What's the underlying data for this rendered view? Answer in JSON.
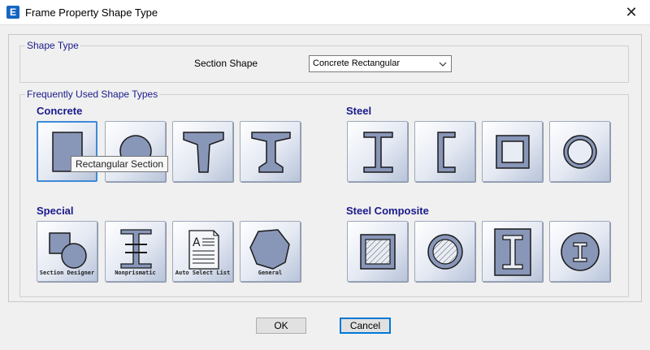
{
  "window": {
    "title": "Frame Property Shape Type",
    "app_icon_letter": "E",
    "close_glyph": "✕"
  },
  "shape_type": {
    "group_title": "Shape Type",
    "label": "Section Shape",
    "selected_value": "Concrete Rectangular",
    "dropdown_icon": "chevron-down-icon"
  },
  "frequent": {
    "group_title": "Frequently Used Shape Types",
    "categories": {
      "concrete": "Concrete",
      "steel": "Steel",
      "special": "Special",
      "steel_composite": "Steel Composite"
    },
    "special_captions": {
      "section_designer": "Section Designer",
      "nonprismatic": "Nonprismatic",
      "auto_select": "Auto Select List",
      "general": "General"
    },
    "tooltip": "Rectangular Section"
  },
  "buttons": {
    "ok": "OK",
    "cancel": "Cancel"
  },
  "colors": {
    "accent_blue": "#1a1a8c",
    "shape_fill": "#8896b8",
    "selection_border": "#3d8ad8"
  }
}
